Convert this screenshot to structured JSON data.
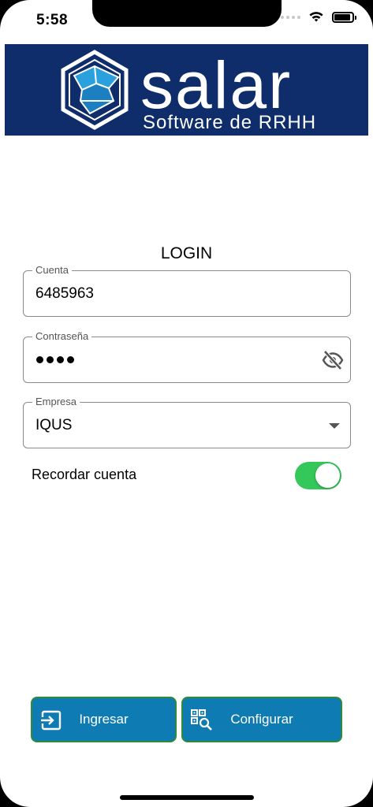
{
  "status_bar": {
    "time": "5:58"
  },
  "banner": {
    "brand_name": "salar",
    "tagline": "Software de RRHH"
  },
  "login": {
    "title": "LOGIN",
    "account": {
      "label": "Cuenta",
      "value": "6485963"
    },
    "password": {
      "label": "Contraseña",
      "masked_length": 4
    },
    "company": {
      "label": "Empresa",
      "selected": "IQUS"
    },
    "remember": {
      "label": "Recordar cuenta",
      "enabled": true
    }
  },
  "buttons": {
    "login_label": "Ingresar",
    "configure_label": "Configurar"
  },
  "colors": {
    "banner_bg": "#0f2c6b",
    "button_bg": "#0e7bb2",
    "button_border": "#2e8b3c",
    "toggle_on": "#34c759"
  },
  "icons": [
    "wifi-icon",
    "battery-icon",
    "logo-icon",
    "eye-off-icon",
    "dropdown-caret-icon",
    "login-icon",
    "qr-search-icon"
  ]
}
